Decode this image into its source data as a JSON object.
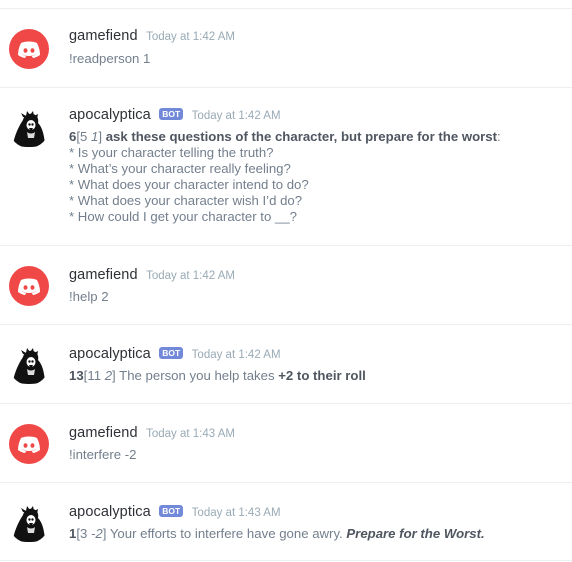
{
  "messages": [
    {
      "author": "gamefiend",
      "time": "Today at 1:42 AM",
      "text": "!readperson 1"
    },
    {
      "author": "apocalyptica",
      "bot_tag": "BOT",
      "time": "Today at 1:42 AM",
      "roll": {
        "total": "6",
        "open": "[5 ",
        "mod": "1",
        "close": "]",
        "text": " ask these questions of the character, but prepare for the worst",
        "tail": ":"
      },
      "lines": [
        "* Is your character telling the truth?",
        "* What’s your character really feeling?",
        "* What does your character intend to do?",
        "* What does your character wish I’d do?",
        "* How could I get your character to __?"
      ]
    },
    {
      "author": "gamefiend",
      "time": "Today at 1:42 AM",
      "text": "!help 2"
    },
    {
      "author": "apocalyptica",
      "bot_tag": "BOT",
      "time": "Today at 1:42 AM",
      "roll": {
        "total": "13",
        "open": "[11 ",
        "mod": "2",
        "close": "]",
        "text": " The person you help takes ",
        "bold": "+2 to their roll"
      }
    },
    {
      "author": "gamefiend",
      "time": "Today at 1:43 AM",
      "text": "!interfere -2"
    },
    {
      "author": "apocalyptica",
      "bot_tag": "BOT",
      "time": "Today at 1:43 AM",
      "roll": {
        "total": "1",
        "open": "[3 ",
        "mod": "-2",
        "close": "]",
        "text": " Your efforts to interfere have gone awry. ",
        "bolditalic": "Prepare for the Worst."
      }
    }
  ]
}
